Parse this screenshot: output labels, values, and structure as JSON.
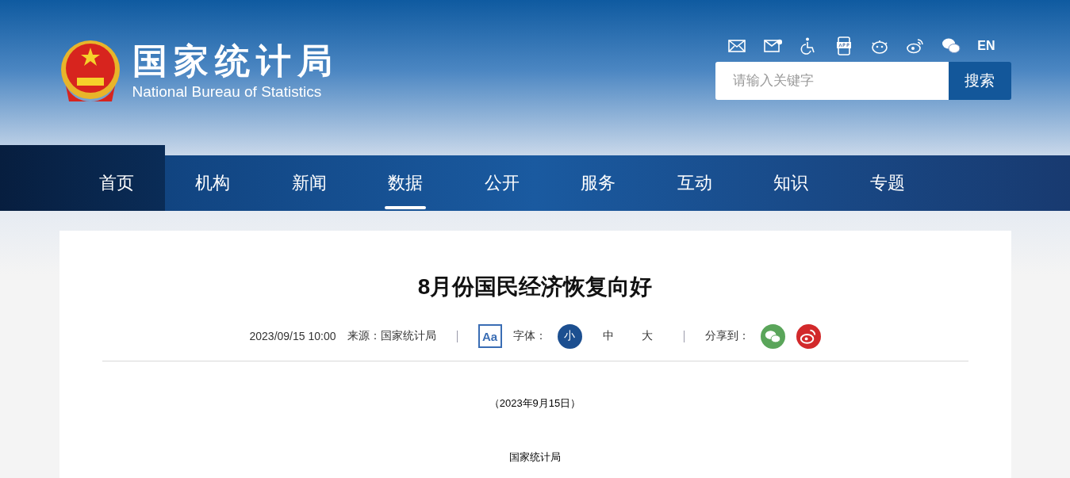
{
  "header": {
    "logo_title": "国家统计局",
    "logo_subtitle": "National Bureau of Statistics",
    "language_link": "EN",
    "search": {
      "placeholder": "请输入关键字",
      "button": "搜索"
    }
  },
  "nav": [
    {
      "label": "首页",
      "kind": "home",
      "selected": false
    },
    {
      "label": "机构",
      "kind": "link",
      "selected": false
    },
    {
      "label": "新闻",
      "kind": "link",
      "selected": false
    },
    {
      "label": "数据",
      "kind": "link",
      "selected": true
    },
    {
      "label": "公开",
      "kind": "link",
      "selected": false
    },
    {
      "label": "服务",
      "kind": "link",
      "selected": false
    },
    {
      "label": "互动",
      "kind": "link",
      "selected": false
    },
    {
      "label": "知识",
      "kind": "link",
      "selected": false
    },
    {
      "label": "专题",
      "kind": "link",
      "selected": false
    }
  ],
  "article": {
    "title": "8月份国民经济恢复向好",
    "date": "2023/09/15 10:00",
    "source": "来源：国家统计局",
    "font_icon": "Aa",
    "font_label": "字体：",
    "font_sizes": [
      {
        "label": "小",
        "selected": true
      },
      {
        "label": "中",
        "selected": false
      },
      {
        "label": "大",
        "selected": false
      }
    ],
    "share_label": "分享到：",
    "paragraphs": [
      "（2023年9月15日）",
      "国家统计局"
    ]
  }
}
